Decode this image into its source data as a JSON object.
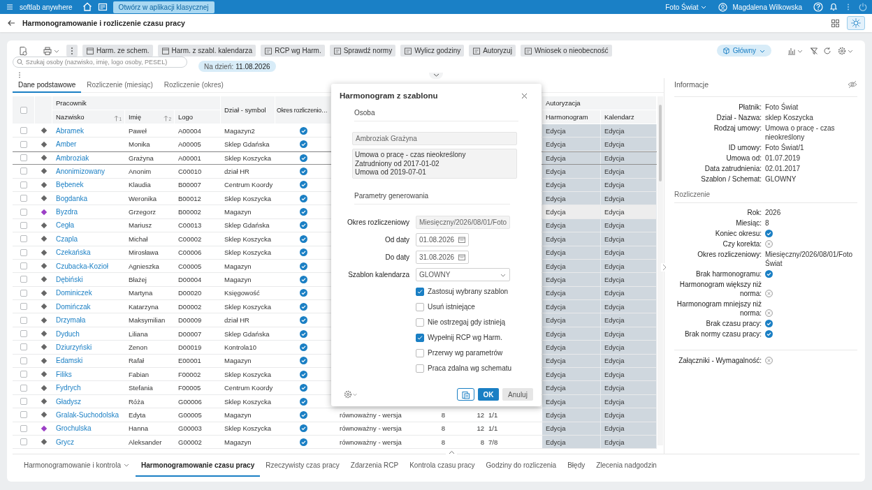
{
  "top_bar": {
    "app_name": "softlab anywhere",
    "classic_button": "Otwórz w aplikacji klasycznej",
    "company": "Foto Świat",
    "user": "Magdalena Wilkowska"
  },
  "header": {
    "title": "Harmonogramowanie i rozliczenie czasu pracy"
  },
  "toolbar": {
    "buttons": [
      {
        "label": "Harm. ze schem."
      },
      {
        "label": "Harm. z szabl. kalendarza"
      },
      {
        "label": "RCP wg Harm."
      },
      {
        "label": "Sprawdź normy"
      },
      {
        "label": "Wylicz godziny"
      },
      {
        "label": "Autoryzuj"
      },
      {
        "label": "Wniosek o nieobecność"
      }
    ],
    "view_selector": "Główny"
  },
  "search": {
    "placeholder": "Szukaj osoby (nazwisko, imię, logo osoby, PESEL)"
  },
  "date_filter": {
    "label": "Na dzień:",
    "value": "11.08.2026"
  },
  "tabs": [
    {
      "label": "Dane podstawowe",
      "selected": true
    },
    {
      "label": "Rozliczenie (miesiąc)",
      "selected": false
    },
    {
      "label": "Rozliczenie (okres)",
      "selected": false
    }
  ],
  "table": {
    "all_checked": false,
    "groups": [
      "Pracownik",
      "Autoryzacja"
    ],
    "columns": [
      {
        "label": "Nazwisko",
        "sort": "1"
      },
      {
        "label": "Imię",
        "sort": "2"
      },
      {
        "label": "Logo"
      },
      {
        "label": "Dział - symbol"
      },
      {
        "label": "Okres rozliczenio…"
      },
      {
        "label": "Harmonogram"
      },
      {
        "label": "Kalendarz"
      }
    ],
    "rows": [
      {
        "checked": false,
        "selected": false,
        "hover": false,
        "color": "#666666",
        "surname": "Abramek",
        "first_name": "Paweł",
        "logo": "A00004",
        "department": "Magazyn2",
        "period_ok": true,
        "schedule": "Edycja",
        "calendar": "Edycja"
      },
      {
        "checked": false,
        "selected": false,
        "hover": false,
        "color": "#666666",
        "surname": "Amber",
        "first_name": "Monika",
        "logo": "A00005",
        "department": "Sklep Gdańska",
        "period_ok": true,
        "schedule": "Edycja",
        "calendar": "Edycja"
      },
      {
        "checked": false,
        "selected": true,
        "hover": false,
        "color": "#666666",
        "surname": "Ambroziak",
        "first_name": "Grażyna",
        "logo": "A00001",
        "department": "Sklep Koszycka",
        "period_ok": true,
        "schedule": "Edycja",
        "calendar": "Edycja"
      },
      {
        "checked": false,
        "selected": false,
        "hover": false,
        "color": "#666666",
        "surname": "Anonimizowany",
        "first_name": "Anonim",
        "logo": "C00010",
        "department": "dział HR",
        "period_ok": true,
        "schedule": "Edycja",
        "calendar": "Edycja"
      },
      {
        "checked": false,
        "selected": false,
        "hover": false,
        "color": "#666666",
        "surname": "Bębenek",
        "first_name": "Klaudia",
        "logo": "B00007",
        "department": "Centrum Koordy",
        "period_ok": true,
        "schedule": "Edycja",
        "calendar": "Edycja"
      },
      {
        "checked": false,
        "selected": false,
        "hover": false,
        "color": "#666666",
        "surname": "Bogdanka",
        "first_name": "Weronika",
        "logo": "B00012",
        "department": "Sklep Koszycka",
        "period_ok": true,
        "schedule": "Edycja",
        "calendar": "Edycja"
      },
      {
        "checked": false,
        "selected": false,
        "hover": true,
        "color": "#9b3fc6",
        "surname": "Byzdra",
        "first_name": "Grzegorz",
        "logo": "B00002",
        "department": "Magazyn",
        "period_ok": true,
        "schedule": "Edycja",
        "calendar": "Edycja"
      },
      {
        "checked": false,
        "selected": false,
        "hover": false,
        "color": "#666666",
        "surname": "Cegła",
        "first_name": "Mariusz",
        "logo": "C00013",
        "department": "Sklep Gdańska",
        "period_ok": true,
        "schedule": "Edycja",
        "calendar": "Edycja"
      },
      {
        "checked": false,
        "selected": false,
        "hover": false,
        "color": "#666666",
        "surname": "Czapla",
        "first_name": "Michał",
        "logo": "C00002",
        "department": "Sklep Koszycka",
        "period_ok": true,
        "schedule": "Edycja",
        "calendar": "Edycja"
      },
      {
        "checked": false,
        "selected": false,
        "hover": false,
        "color": "#666666",
        "surname": "Czekańska",
        "first_name": "Mirosława",
        "logo": "C00006",
        "department": "Sklep Koszycka",
        "period_ok": true,
        "schedule": "Edycja",
        "calendar": "Edycja"
      },
      {
        "checked": false,
        "selected": false,
        "hover": false,
        "color": "#666666",
        "surname": "Czubacka-Kozioł",
        "first_name": "Agnieszka",
        "logo": "C00005",
        "department": "Magazyn",
        "period_ok": true,
        "schedule": "Edycja",
        "calendar": "Edycja"
      },
      {
        "checked": false,
        "selected": false,
        "hover": false,
        "color": "#666666",
        "surname": "Dębiński",
        "first_name": "Błażej",
        "logo": "D00004",
        "department": "Magazyn",
        "period_ok": true,
        "schedule": "Edycja",
        "calendar": "Edycja"
      },
      {
        "checked": false,
        "selected": false,
        "hover": false,
        "color": "#666666",
        "surname": "Dominiczek",
        "first_name": "Martyna",
        "logo": "D00020",
        "department": "Księgowość",
        "period_ok": true,
        "schedule": "Edycja",
        "calendar": "Edycja"
      },
      {
        "checked": false,
        "selected": false,
        "hover": false,
        "color": "#666666",
        "surname": "Domińczak",
        "first_name": "Katarzyna",
        "logo": "D00002",
        "department": "Sklep Koszycka",
        "period_ok": true,
        "schedule": "Edycja",
        "calendar": "Edycja"
      },
      {
        "checked": false,
        "selected": false,
        "hover": false,
        "color": "#666666",
        "surname": "Drzymała",
        "first_name": "Maksymilian",
        "logo": "D00009",
        "department": "dział HR",
        "period_ok": true,
        "schedule": "Edycja",
        "calendar": "Edycja"
      },
      {
        "checked": false,
        "selected": false,
        "hover": false,
        "color": "#666666",
        "surname": "Dyduch",
        "first_name": "Liliana",
        "logo": "D00007",
        "department": "Sklep Gdańska",
        "period_ok": true,
        "schedule": "Edycja",
        "calendar": "Edycja"
      },
      {
        "checked": false,
        "selected": false,
        "hover": false,
        "color": "#666666",
        "surname": "Dziurzyński",
        "first_name": "Zenon",
        "logo": "D00019",
        "department": "Kontrola10",
        "period_ok": true,
        "schedule": "Edycja",
        "calendar": "Edycja"
      },
      {
        "checked": false,
        "selected": false,
        "hover": false,
        "color": "#666666",
        "surname": "Edamski",
        "first_name": "Rafał",
        "logo": "E00001",
        "department": "Magazyn",
        "period_ok": true,
        "schedule": "Edycja",
        "calendar": "Edycja"
      },
      {
        "checked": false,
        "selected": false,
        "hover": false,
        "color": "#666666",
        "surname": "Filiks",
        "first_name": "Fabian",
        "logo": "F00002",
        "department": "Sklep Koszycka",
        "period_ok": true,
        "schedule": "Edycja",
        "calendar": "Edycja"
      },
      {
        "checked": false,
        "selected": false,
        "hover": false,
        "color": "#666666",
        "surname": "Fydrych",
        "first_name": "Stefania",
        "logo": "F00005",
        "department": "Centrum Koordy",
        "period_ok": true,
        "schedule": "Edycja",
        "calendar": "Edycja"
      },
      {
        "checked": false,
        "selected": false,
        "hover": false,
        "color": "#666666",
        "surname": "Gładysz",
        "first_name": "Róża",
        "logo": "G00006",
        "department": "Sklep Koszycka",
        "period_ok": true,
        "schedule": "Edycja",
        "calendar": "Edycja"
      },
      {
        "checked": false,
        "selected": false,
        "hover": false,
        "color": "#666666",
        "surname": "Gralak-Suchodolska",
        "first_name": "Edyta",
        "logo": "G00005",
        "department": "Magazyn",
        "period_ok": true,
        "column_8": "równoważny - wersja",
        "column_9": "8",
        "column_10": "12",
        "column_11": "1/1",
        "schedule": "Edycja",
        "calendar": "Edycja"
      },
      {
        "checked": false,
        "selected": false,
        "hover": false,
        "color": "#9b3fc6",
        "surname": "Grochulska",
        "first_name": "Hanna",
        "logo": "G00003",
        "department": "Sklep Koszycka",
        "period_ok": true,
        "column_8": "równoważny - wersja",
        "column_9": "8",
        "column_10": "12",
        "column_11": "1/1",
        "schedule": "Edycja",
        "calendar": "Edycja"
      },
      {
        "checked": false,
        "selected": false,
        "hover": false,
        "color": "#666666",
        "surname": "Grycz",
        "first_name": "Aleksander",
        "logo": "G00002",
        "department": "Magazyn",
        "period_ok": true,
        "column_8": "równoważny - wersja",
        "column_9": "8",
        "column_10": "8",
        "column_11": "7/8",
        "schedule": "Edycja",
        "calendar": "Edycja"
      }
    ]
  },
  "info_panel": {
    "title": "Informacje",
    "sections": [
      {
        "rows": [
          {
            "label": "Płatnik:",
            "kind": "text",
            "value": "Foto Świat"
          },
          {
            "label": "Dział - Nazwa:",
            "kind": "text",
            "value": "sklep Koszycka"
          },
          {
            "label": "Rodzaj umowy:",
            "kind": "text",
            "value": "Umowa o pracę - czas nieokreślony"
          },
          {
            "label": "ID umowy:",
            "kind": "text",
            "value": "Foto Świat/1"
          },
          {
            "label": "Umowa od:",
            "kind": "text",
            "value": "01.07.2019"
          },
          {
            "label": "Data zatrudnienia:",
            "kind": "text",
            "value": "02.01.2017"
          },
          {
            "label": "Szablon / Schemat:",
            "kind": "text",
            "value": "GLOWNY"
          }
        ]
      },
      {
        "title": "Rozliczenie",
        "rows": [
          {
            "label": "Rok:",
            "kind": "text",
            "value": "2026"
          },
          {
            "label": "Miesiąc:",
            "kind": "text",
            "value": "8"
          },
          {
            "label": "Koniec okresu:",
            "kind": "flag",
            "on": true
          },
          {
            "label": "Czy korekta:",
            "kind": "flag",
            "on": false
          },
          {
            "label": "Okres rozliczeniowy:",
            "kind": "text",
            "value": "Miesięczny/2026/08/01/Foto Świat"
          },
          {
            "label": "Brak harmonogramu:",
            "kind": "flag",
            "on": true
          },
          {
            "label": "Harmonogram większy niż norma:",
            "kind": "flag",
            "on": false
          },
          {
            "label": "Harmonogram mniejszy niż norma:",
            "kind": "flag",
            "on": false
          },
          {
            "label": "Brak czasu pracy:",
            "kind": "flag",
            "on": true
          },
          {
            "label": "Brak normy czasu pracy:",
            "kind": "flag",
            "on": true
          }
        ]
      },
      {
        "rows": [
          {
            "label": "Załączniki - Wymagalność:",
            "kind": "flag",
            "on": false
          }
        ]
      }
    ]
  },
  "bottom_tabs": [
    {
      "label": "Harmonogramowanie i kontrola",
      "dropdown": true,
      "selected": false
    },
    {
      "label": "Harmonogramowanie czasu pracy",
      "selected": true
    },
    {
      "label": "Rzeczywisty czas pracy",
      "selected": false
    },
    {
      "label": "Zdarzenia RCP",
      "selected": false
    },
    {
      "label": "Kontrola czasu pracy",
      "selected": false
    },
    {
      "label": "Godziny do rozliczenia",
      "selected": false
    },
    {
      "label": "Błędy",
      "selected": false
    },
    {
      "label": "Zlecenia nadgodzin",
      "selected": false
    }
  ],
  "dialog": {
    "title": "Harmonogram z szablonu",
    "person_section": "Osoba",
    "person_name": "Ambroziak Grażyna",
    "contract_lines": [
      "Umowa o pracę - czas nieokreślony",
      "Zatrudniony od 2017-01-02",
      "Umowa od 2019-07-01"
    ],
    "params_section": "Parametry generowania",
    "fields": [
      {
        "label": "Okres rozliczeniowy",
        "kind": "readonly",
        "value": "Miesięczny/2026/08/01/Foto"
      },
      {
        "label": "Od daty",
        "kind": "date",
        "value": "01.08.2026"
      },
      {
        "label": "Do daty",
        "kind": "date",
        "value": "31.08.2026"
      },
      {
        "label": "Szablon kalendarza",
        "kind": "select",
        "value": "GLOWNY"
      }
    ],
    "options": [
      {
        "label": "Zastosuj wybrany szablon",
        "checked": true
      },
      {
        "label": "Usuń istniejące",
        "checked": false
      },
      {
        "label": "Nie ostrzegaj gdy istnieją",
        "checked": false
      },
      {
        "label": "Wypełnij RCP wg Harm.",
        "checked": true
      },
      {
        "label": "Przerwy wg parametrów",
        "checked": false
      },
      {
        "label": "Praca zdalna wg schematu",
        "checked": false
      }
    ],
    "ok": "OK",
    "cancel": "Anuluj"
  }
}
